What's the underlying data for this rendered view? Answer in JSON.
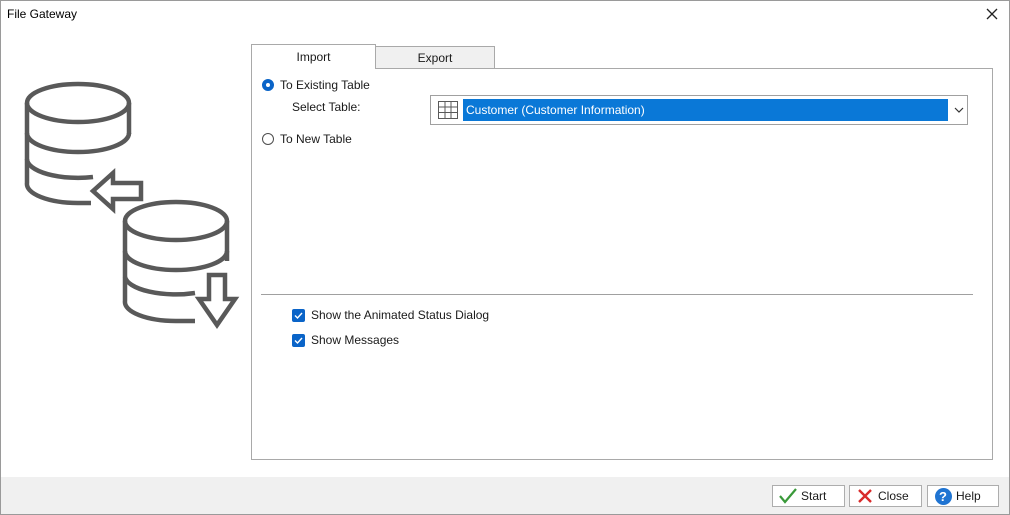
{
  "window": {
    "title": "File Gateway"
  },
  "tabs": [
    {
      "label": "Import",
      "selected": true
    },
    {
      "label": "Export",
      "selected": false
    }
  ],
  "import": {
    "to_existing_label": "To Existing Table",
    "to_existing_checked": true,
    "select_table_label": "Select Table:",
    "selected_table": "Customer  (Customer Information)",
    "to_new_label": "To New Table",
    "to_new_checked": false
  },
  "options": {
    "animated_status_label": "Show the Animated Status Dialog",
    "animated_status_checked": true,
    "show_messages_label": "Show Messages",
    "show_messages_checked": true
  },
  "buttons": {
    "start": "Start",
    "close": "Close",
    "help": "Help"
  },
  "icons": {
    "illustration": "database-import-export-icon",
    "table": "table-grid-icon",
    "start": "checkmark-icon",
    "close": "red-x-icon",
    "help": "question-mark-icon"
  },
  "colors": {
    "accent": "#0a64c8",
    "selection": "#0a78d7",
    "close_red": "#d92b2b",
    "start_green": "#3a9a3a",
    "footer_bg": "#f0f0f0"
  }
}
